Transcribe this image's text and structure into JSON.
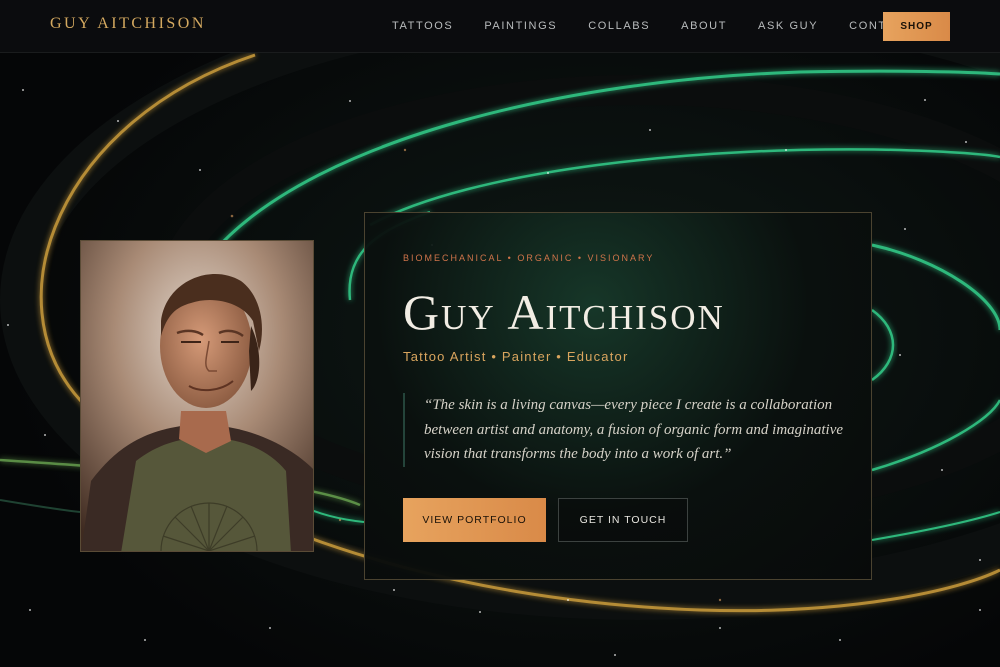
{
  "header": {
    "logo": "GUY AITCHISON",
    "nav": [
      "TATTOOS",
      "PAINTINGS",
      "COLLABS",
      "ABOUT",
      "ASK GUY",
      "CONTACT"
    ],
    "shop_label": "SHOP"
  },
  "hero": {
    "tagline": "BIOMECHANICAL • ORGANIC • VISIONARY",
    "title": "Guy Aitchison",
    "subtitle": "Tattoo Artist • Painter • Educator",
    "quote": "“The skin is a living canvas—every piece I create is a collaboration between artist and anatomy, a fusion of organic form and imaginative vision that transforms the body into a work of art.”",
    "primary_button": "VIEW PORTFOLIO",
    "secondary_button": "GET IN TOUCH"
  },
  "colors": {
    "accent": "#e0995a",
    "gold": "#d4a960",
    "orbit_green": "#2fb87c",
    "background": "#060807"
  }
}
